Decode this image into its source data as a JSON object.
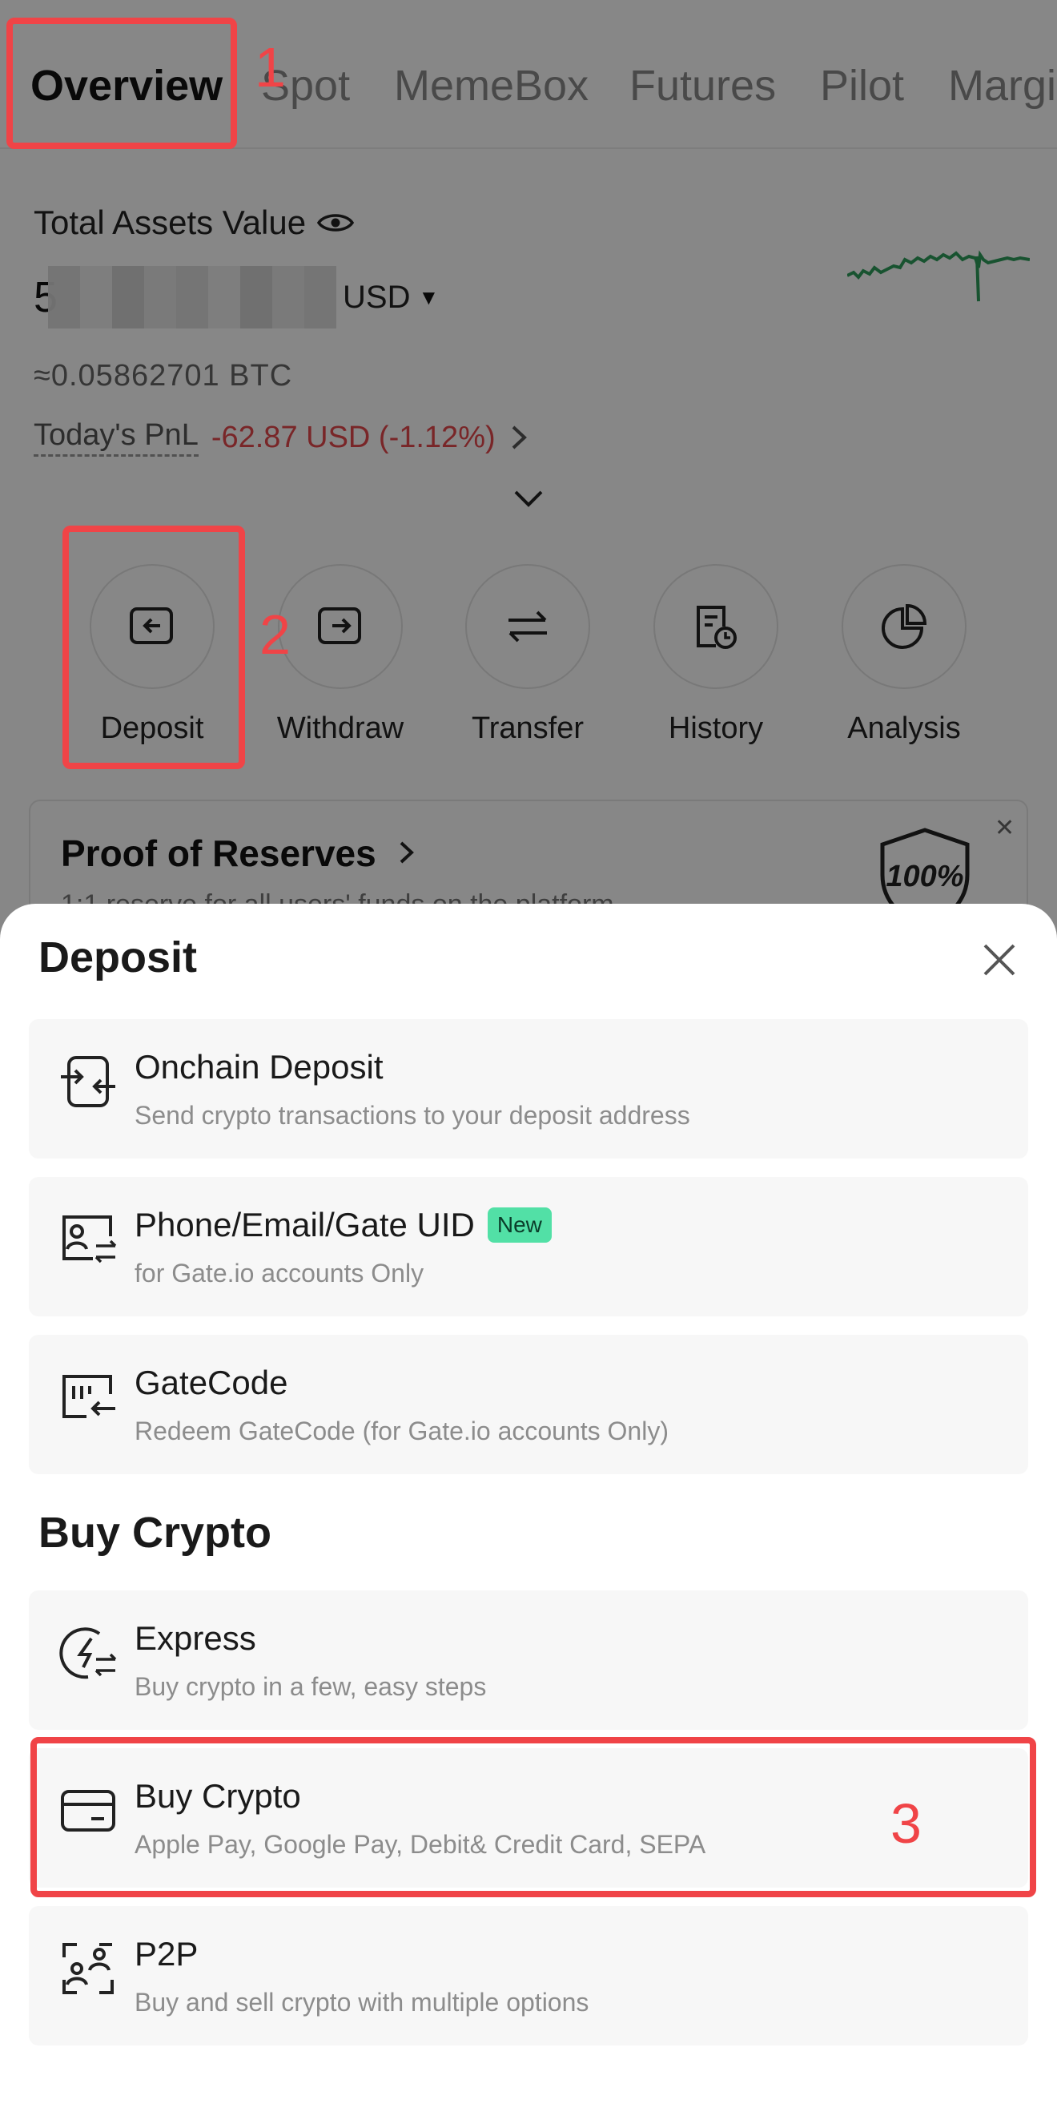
{
  "tabs": [
    "Overview",
    "Spot",
    "MemeBox",
    "Futures",
    "Pilot",
    "Margi"
  ],
  "assets": {
    "label": "Total Assets Value",
    "value_visible_digit": "5",
    "currency": "USD",
    "btc": "≈0.05862701  BTC",
    "pnl_label": "Today's PnL",
    "pnl_value": "-62.87 USD (-1.12%)"
  },
  "actions": [
    {
      "label": "Deposit",
      "icon": "deposit-icon"
    },
    {
      "label": "Withdraw",
      "icon": "withdraw-icon"
    },
    {
      "label": "Transfer",
      "icon": "transfer-icon"
    },
    {
      "label": "History",
      "icon": "history-icon"
    },
    {
      "label": "Analysis",
      "icon": "analysis-icon"
    }
  ],
  "proof": {
    "title": "Proof of Reserves",
    "subtitle": "1:1 reserve for all users' funds on the platform",
    "badge": "100%"
  },
  "annotations": [
    "1",
    "2",
    "3"
  ],
  "sheet": {
    "title": "Deposit",
    "deposit_options": [
      {
        "title": "Onchain Deposit",
        "subtitle": "Send crypto transactions to your deposit address",
        "icon": "onchain-deposit-icon"
      },
      {
        "title": "Phone/Email/Gate UID",
        "badge": "New",
        "subtitle": "for Gate.io accounts Only",
        "icon": "user-transfer-icon"
      },
      {
        "title": "GateCode",
        "subtitle": "Redeem GateCode (for Gate.io accounts Only)",
        "icon": "gatecode-icon"
      }
    ],
    "buy_section_title": "Buy Crypto",
    "buy_options": [
      {
        "title": "Express",
        "subtitle": "Buy crypto in a few, easy steps",
        "icon": "express-icon"
      },
      {
        "title": "Buy Crypto",
        "subtitle": "Apple Pay, Google Pay, Debit& Credit Card, SEPA",
        "icon": "card-icon"
      },
      {
        "title": "P2P",
        "subtitle": "Buy and sell crypto with multiple options",
        "icon": "p2p-icon"
      }
    ]
  },
  "colors": {
    "annotation": "#f04447",
    "pnl_negative": "#e5484d",
    "sparkline": "#2e9e5b",
    "new_badge": "#52e0a6"
  }
}
